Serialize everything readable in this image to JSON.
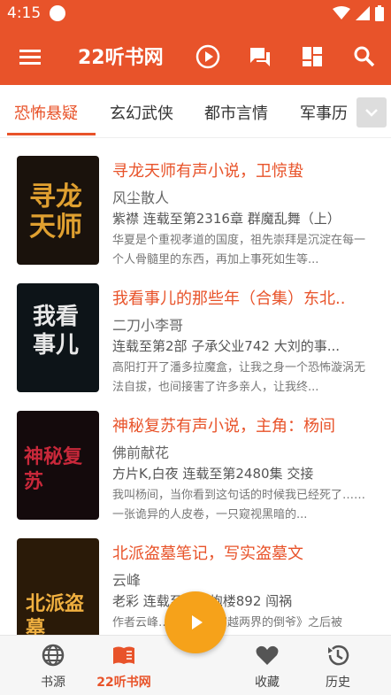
{
  "status": {
    "time": "4:15"
  },
  "appbar": {
    "title": "22听书网"
  },
  "tabs": [
    "恐怖悬疑",
    "玄幻武侠",
    "都市言情",
    "军事历"
  ],
  "books": [
    {
      "title": "寻龙天师有声小说，卫惊蛰",
      "author": "风尘散人",
      "meta": "紫襟   连载至第2316章 群魔乱舞（上）",
      "desc": "华夏是个重视孝道的国度，祖先崇拜是沉淀在每一个人骨髓里的东西，再加上事死如生等...",
      "cover_text": "寻龙天师"
    },
    {
      "title": "我看事儿的那些年（合集）东北..",
      "author": "二刀小李哥",
      "meta": "    连载至第2部 子承父业742 大刘的事...",
      "desc": "高阳打开了潘多拉魔盒，让我之身一个恐怖漩涡无法自拔，也间接害了许多亲人，让我终...",
      "cover_text": "我看事儿"
    },
    {
      "title": "神秘复苏有声小说，主角：杨间",
      "author": "佛前献花",
      "meta": "方片K,白夜          连载至第2480集 交接",
      "desc": "我叫杨间，当你看到这句话的时候我已经死了……一张诡异的人皮卷，一只窥视黑暗的...",
      "cover_text": "神秘复苏"
    },
    {
      "title": "北派盗墓笔记，写实盗墓文",
      "author": "云峰",
      "meta": "老彩                    连载至天府炮楼892 闯祸",
      "desc": "作者云峰…………《穿越两界的倒爷》之后被抓……的倾么那位………找到………",
      "cover_text": "北派盗墓"
    }
  ],
  "nav": [
    {
      "label": "书源"
    },
    {
      "label": "22听书网"
    },
    {
      "label": "收藏"
    },
    {
      "label": "历史"
    }
  ],
  "colors": {
    "primary": "#e8532a",
    "fab": "#f6a21a"
  }
}
